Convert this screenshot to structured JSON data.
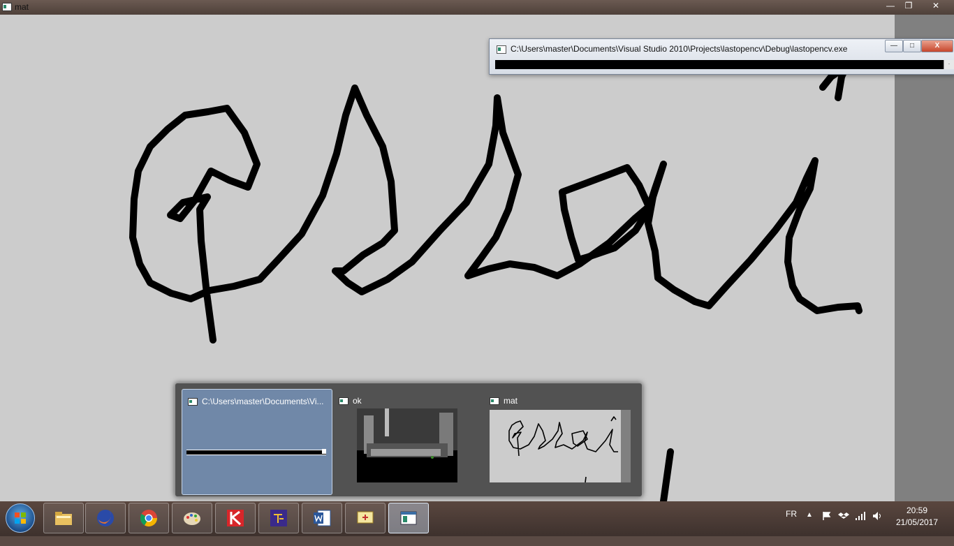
{
  "window": {
    "title": "mat",
    "minimize": "—",
    "restore": "❐",
    "close": "✕"
  },
  "console": {
    "title": "C:\\Users\\master\\Documents\\Visual Studio 2010\\Projects\\lastopencv\\Debug\\lastopencv.exe",
    "minimize": "—",
    "maximize": "□",
    "close": "X",
    "scroll": "·"
  },
  "thumbnails": [
    {
      "label": "C:\\Users\\master\\Documents\\Vi...",
      "active": true
    },
    {
      "label": "ok",
      "active": false
    },
    {
      "label": "mat",
      "active": false
    }
  ],
  "taskbar": {
    "apps": [
      {
        "name": "windows-explorer",
        "icon": "folder-icon"
      },
      {
        "name": "firefox",
        "icon": "firefox-icon"
      },
      {
        "name": "chrome",
        "icon": "chrome-icon"
      },
      {
        "name": "paint",
        "icon": "palette-icon"
      },
      {
        "name": "kaspersky",
        "icon": "kaspersky-icon"
      },
      {
        "name": "texmaker",
        "icon": "tex-icon"
      },
      {
        "name": "word",
        "icon": "word-icon"
      },
      {
        "name": "snipping-tool",
        "icon": "snipping-icon"
      },
      {
        "name": "opencv-windows",
        "icon": "app-window-icon",
        "active": true
      }
    ],
    "language": "FR",
    "time": "20:59",
    "date": "21/05/2017"
  },
  "colors": {
    "canvas": "#cccccc",
    "ink": "#000000",
    "thumbnail_active": "#7088a8"
  }
}
